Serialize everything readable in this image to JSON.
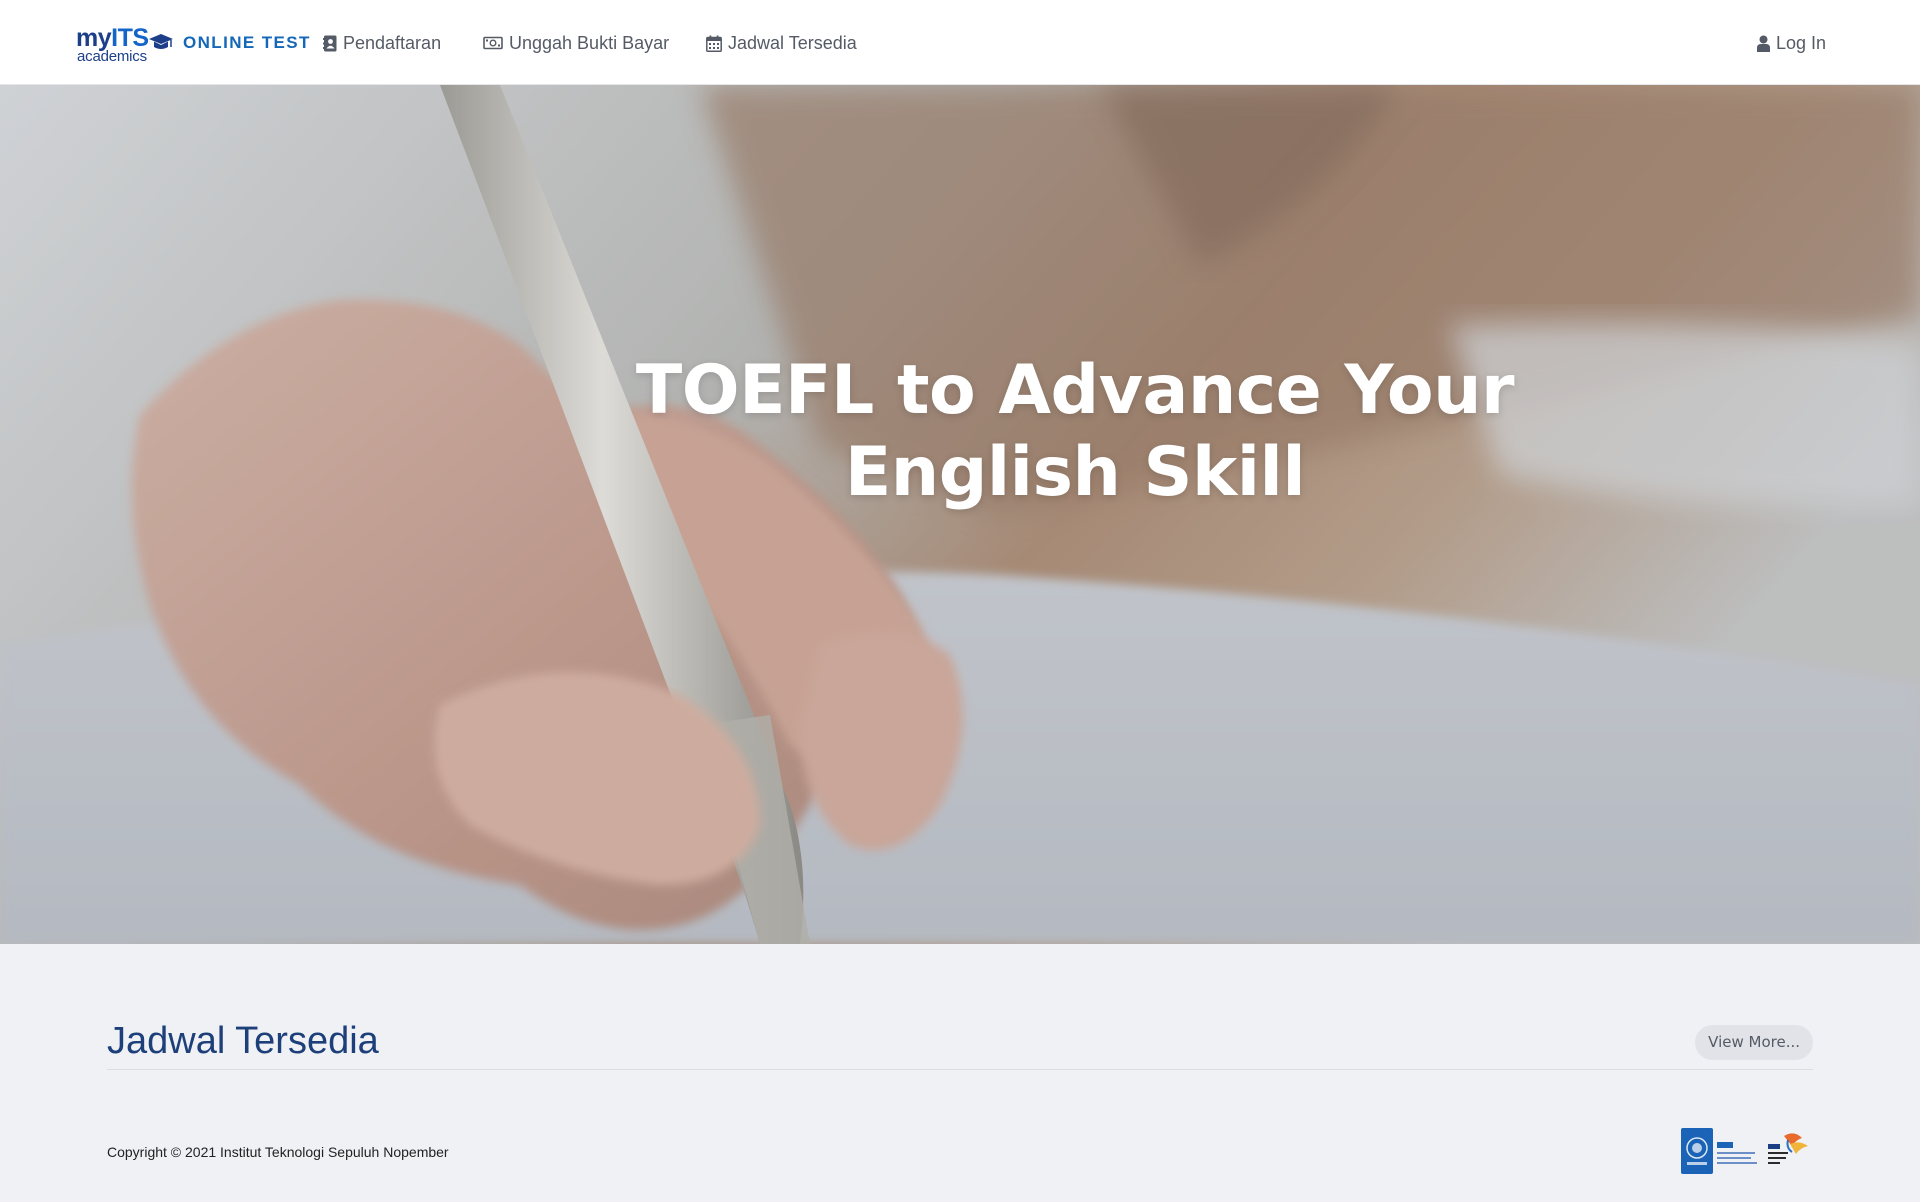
{
  "brand": {
    "my": "my",
    "its": "ITS",
    "academics": "academics",
    "subtitle": "ONLINE TEST"
  },
  "nav": {
    "items": [
      {
        "label": "Pendaftaran",
        "icon": "contact-book-icon"
      },
      {
        "label": "Unggah Bukti Bayar",
        "icon": "money-bill-icon"
      },
      {
        "label": "Jadwal Tersedia",
        "icon": "calendar-icon"
      }
    ],
    "login": {
      "label": "Log In",
      "icon": "user-icon"
    }
  },
  "hero": {
    "title_line1": "TOEFL to Advance Your",
    "title_line2": "English Skill",
    "background": "photo of a hand writing with a pen"
  },
  "schedule": {
    "title": "Jadwal Tersedia",
    "view_more": "View More..."
  },
  "footer": {
    "copyright": "Copyright © 2021 Institut Teknologi Sepuluh Nopember",
    "logos": [
      "its-logo",
      "its-semangat-baru-logo"
    ]
  },
  "colors": {
    "brand_navy": "#1d3f8a",
    "brand_blue": "#1567b8",
    "heading": "#1d3f7a",
    "page_bg": "#f0f1f5",
    "nav_text": "#555b66"
  }
}
